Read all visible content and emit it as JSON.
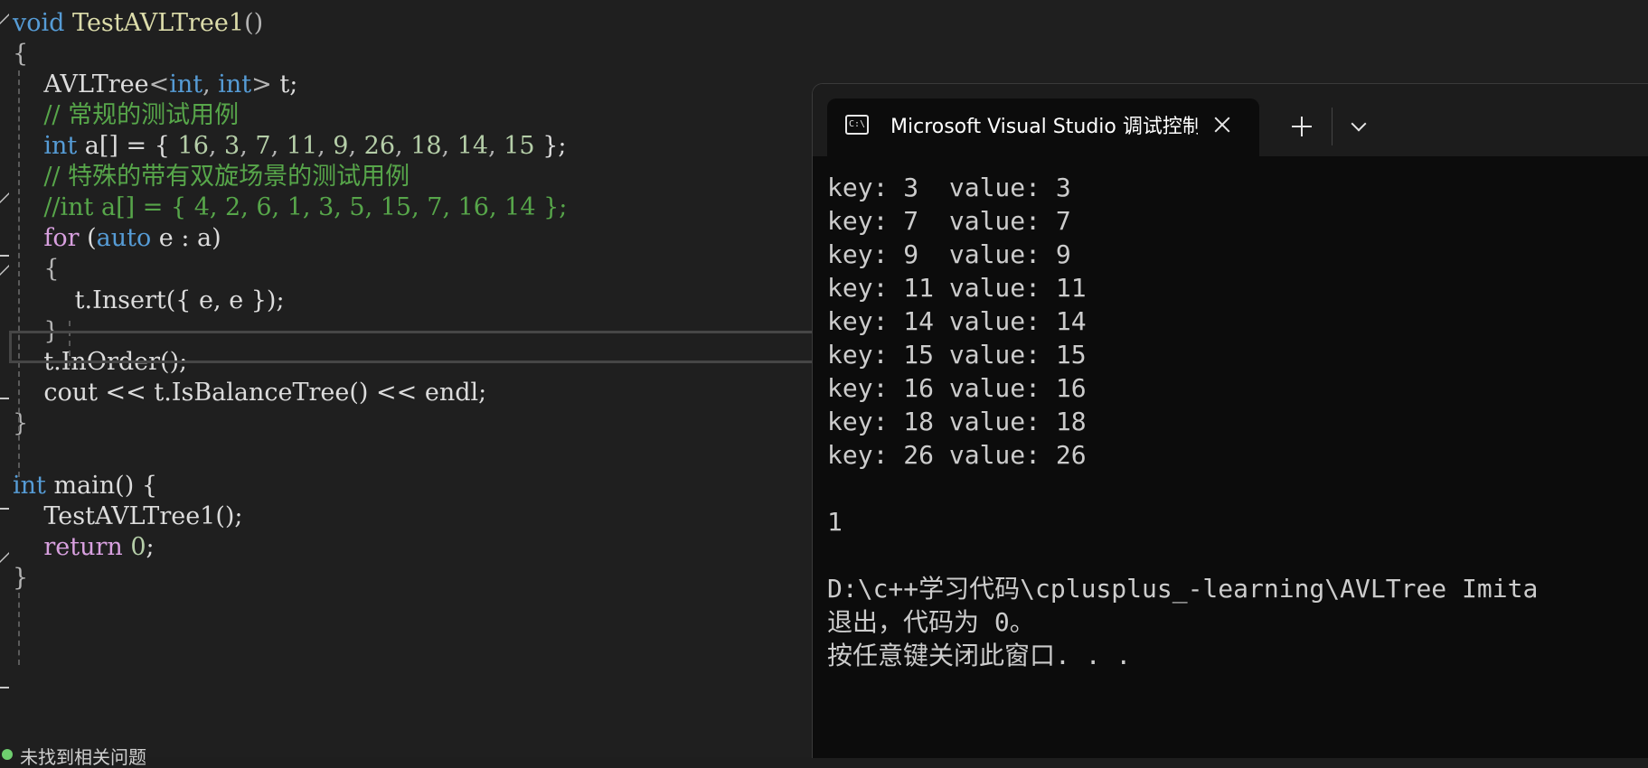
{
  "editor": {
    "lines": [
      [
        {
          "t": "void",
          "c": "kw"
        },
        {
          "t": " ",
          "c": "txt"
        },
        {
          "t": "TestAVLTree1",
          "c": "fn"
        },
        {
          "t": "()",
          "c": "punc"
        }
      ],
      [
        {
          "t": "{",
          "c": "punc"
        }
      ],
      [
        {
          "t": "    AVLTree",
          "c": "txt"
        },
        {
          "t": "<",
          "c": "punc"
        },
        {
          "t": "int",
          "c": "kw"
        },
        {
          "t": ", ",
          "c": "punc"
        },
        {
          "t": "int",
          "c": "kw"
        },
        {
          "t": ">",
          "c": "punc"
        },
        {
          "t": " t;",
          "c": "txt"
        }
      ],
      [
        {
          "t": "    // 常规的测试用例",
          "c": "cm"
        }
      ],
      [
        {
          "t": "    ",
          "c": "txt"
        },
        {
          "t": "int",
          "c": "kw"
        },
        {
          "t": " a[] = { ",
          "c": "txt"
        },
        {
          "t": "16",
          "c": "num"
        },
        {
          "t": ", ",
          "c": "punc"
        },
        {
          "t": "3",
          "c": "num"
        },
        {
          "t": ", ",
          "c": "punc"
        },
        {
          "t": "7",
          "c": "num"
        },
        {
          "t": ", ",
          "c": "punc"
        },
        {
          "t": "11",
          "c": "num"
        },
        {
          "t": ", ",
          "c": "punc"
        },
        {
          "t": "9",
          "c": "num"
        },
        {
          "t": ", ",
          "c": "punc"
        },
        {
          "t": "26",
          "c": "num"
        },
        {
          "t": ", ",
          "c": "punc"
        },
        {
          "t": "18",
          "c": "num"
        },
        {
          "t": ", ",
          "c": "punc"
        },
        {
          "t": "14",
          "c": "num"
        },
        {
          "t": ", ",
          "c": "punc"
        },
        {
          "t": "15",
          "c": "num"
        },
        {
          "t": " };",
          "c": "txt"
        }
      ],
      [
        {
          "t": "    // 特殊的带有双旋场景的测试用例",
          "c": "cm"
        }
      ],
      [
        {
          "t": "    //int a[] = { 4, 2, 6, 1, 3, 5, 15, 7, 16, 14 };",
          "c": "cm"
        }
      ],
      [
        {
          "t": "    ",
          "c": "txt"
        },
        {
          "t": "for",
          "c": "ctl"
        },
        {
          "t": " (",
          "c": "txt"
        },
        {
          "t": "auto",
          "c": "kw"
        },
        {
          "t": " e : a)",
          "c": "txt"
        }
      ],
      [
        {
          "t": "    {",
          "c": "punc"
        }
      ],
      [
        {
          "t": "        t.",
          "c": "txt"
        },
        {
          "t": "Insert",
          "c": "txt"
        },
        {
          "t": "({ e, e });",
          "c": "txt"
        }
      ],
      [
        {
          "t": "    }",
          "c": "punc"
        }
      ],
      [
        {
          "t": "    t.",
          "c": "txt"
        },
        {
          "t": "InOrder",
          "c": "txt"
        },
        {
          "t": "();",
          "c": "txt"
        }
      ],
      [
        {
          "t": "    cout << t.",
          "c": "txt"
        },
        {
          "t": "IsBalanceTree",
          "c": "txt"
        },
        {
          "t": "() << endl;",
          "c": "txt"
        }
      ],
      [
        {
          "t": "}",
          "c": "punc"
        }
      ],
      [
        {
          "t": "",
          "c": "txt"
        }
      ],
      [
        {
          "t": "int",
          "c": "kw"
        },
        {
          "t": " main() {",
          "c": "txt"
        }
      ],
      [
        {
          "t": "    TestAVLTree1",
          "c": "txt"
        },
        {
          "t": "();",
          "c": "txt"
        }
      ],
      [
        {
          "t": "    ",
          "c": "txt"
        },
        {
          "t": "return",
          "c": "ctl"
        },
        {
          "t": " ",
          "c": "txt"
        },
        {
          "t": "0",
          "c": "num"
        },
        {
          "t": ";",
          "c": "txt"
        }
      ],
      [
        {
          "t": "}",
          "c": "punc"
        }
      ]
    ],
    "status_text": "未找到相关问题"
  },
  "terminal": {
    "icon_text": "C:\\",
    "tab_title": "Microsoft Visual Studio 调试控制台",
    "console_lines": [
      "key: 3  value: 3",
      "key: 7  value: 7",
      "key: 9  value: 9",
      "key: 11 value: 11",
      "key: 14 value: 14",
      "key: 15 value: 15",
      "key: 16 value: 16",
      "key: 18 value: 18",
      "key: 26 value: 26",
      "",
      "1",
      "",
      "D:\\c++学习代码\\cplusplus_-learning\\AVLTree Imita",
      "退出，代码为 0。",
      "按任意键关闭此窗口. . ."
    ]
  },
  "colors": {
    "editor_bg": "#1f1f1f",
    "keyword": "#569cd6",
    "control": "#d8a0df",
    "comment": "#57a64a",
    "number": "#b5cea8",
    "console_bg": "#0c0c0c",
    "console_text": "#cccccc"
  },
  "icons": [
    "console-app-icon",
    "close-icon",
    "plus-icon",
    "chevron-down-icon"
  ]
}
